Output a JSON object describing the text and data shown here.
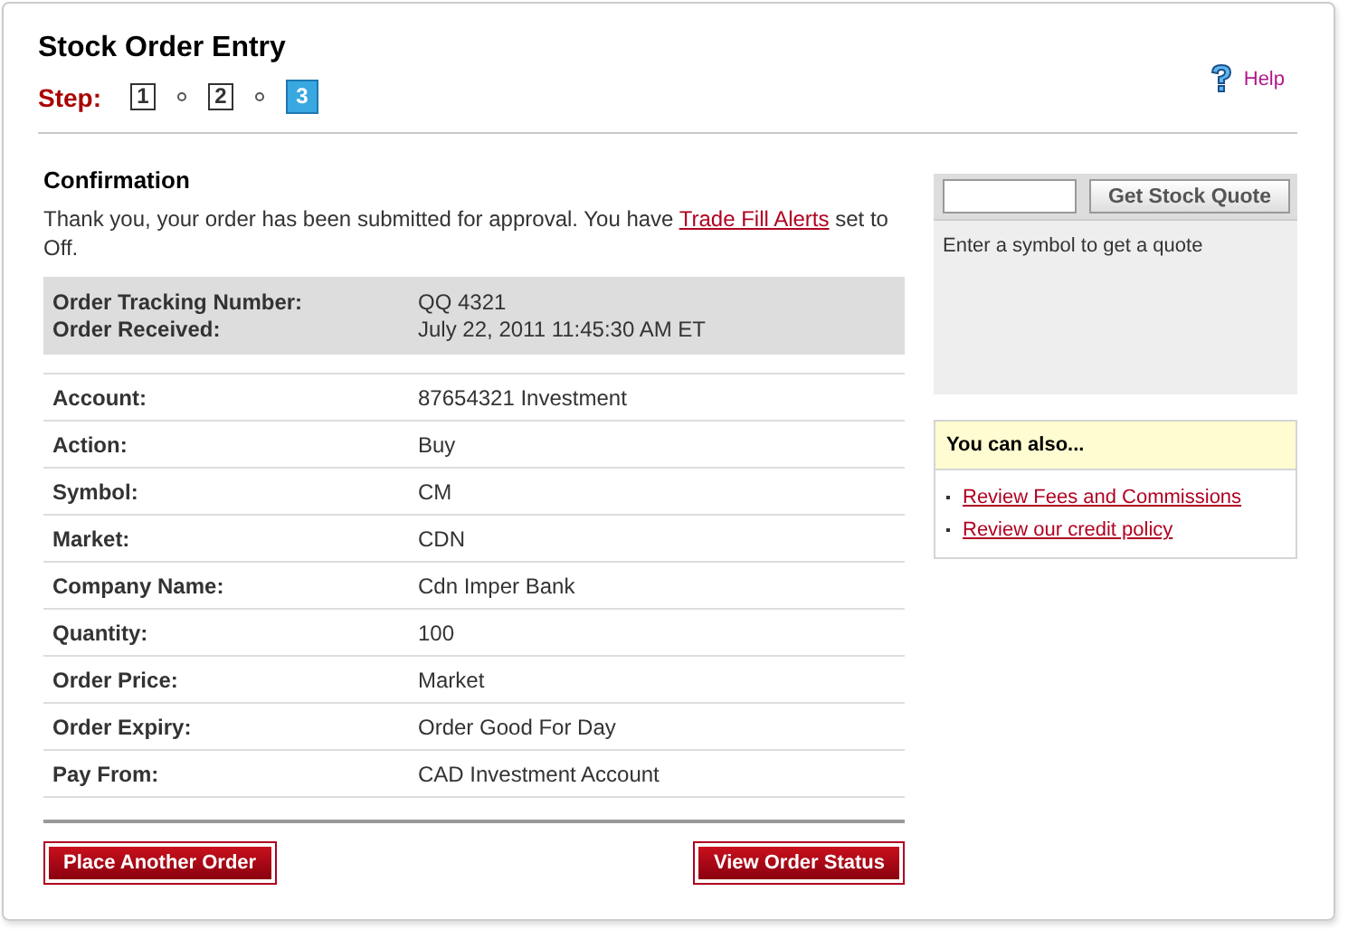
{
  "page": {
    "title": "Stock Order Entry",
    "step_label": "Step:",
    "help": "Help"
  },
  "steps": [
    {
      "label": "1",
      "selected": false
    },
    {
      "label": "2",
      "selected": false
    },
    {
      "label": "3",
      "selected": true
    }
  ],
  "confirmation": {
    "heading": "Confirmation",
    "message_before": "Thank you, your order has been submitted for approval. You have ",
    "message_link": "Trade Fill Alerts",
    "message_after": " set to Off."
  },
  "tracking": [
    {
      "label": "Order Tracking Number:",
      "value": "QQ 4321"
    },
    {
      "label": "Order Received:",
      "value": "July 22, 2011 11:45:30 AM ET"
    }
  ],
  "details": [
    {
      "label": "Account:",
      "value": "87654321 Investment"
    },
    {
      "label": "Action:",
      "value": "Buy"
    },
    {
      "label": "Symbol:",
      "value": "CM"
    },
    {
      "label": "Market:",
      "value": "CDN"
    },
    {
      "label": "Company Name:",
      "value": "Cdn Imper Bank"
    },
    {
      "label": "Quantity:",
      "value": "100"
    },
    {
      "label": "Order Price:",
      "value": "Market"
    },
    {
      "label": "Order Expiry:",
      "value": "Order Good For Day"
    },
    {
      "label": "Pay From:",
      "value": "CAD Investment Account"
    }
  ],
  "buttons": [
    "Place Another Order",
    "View Order Status"
  ],
  "quote": {
    "button": "Get Stock Quote",
    "hint": "Enter a symbol to get a quote"
  },
  "also": {
    "heading": "You can also...",
    "links": [
      "Review Fees and Commissions",
      "Review our credit policy"
    ]
  }
}
